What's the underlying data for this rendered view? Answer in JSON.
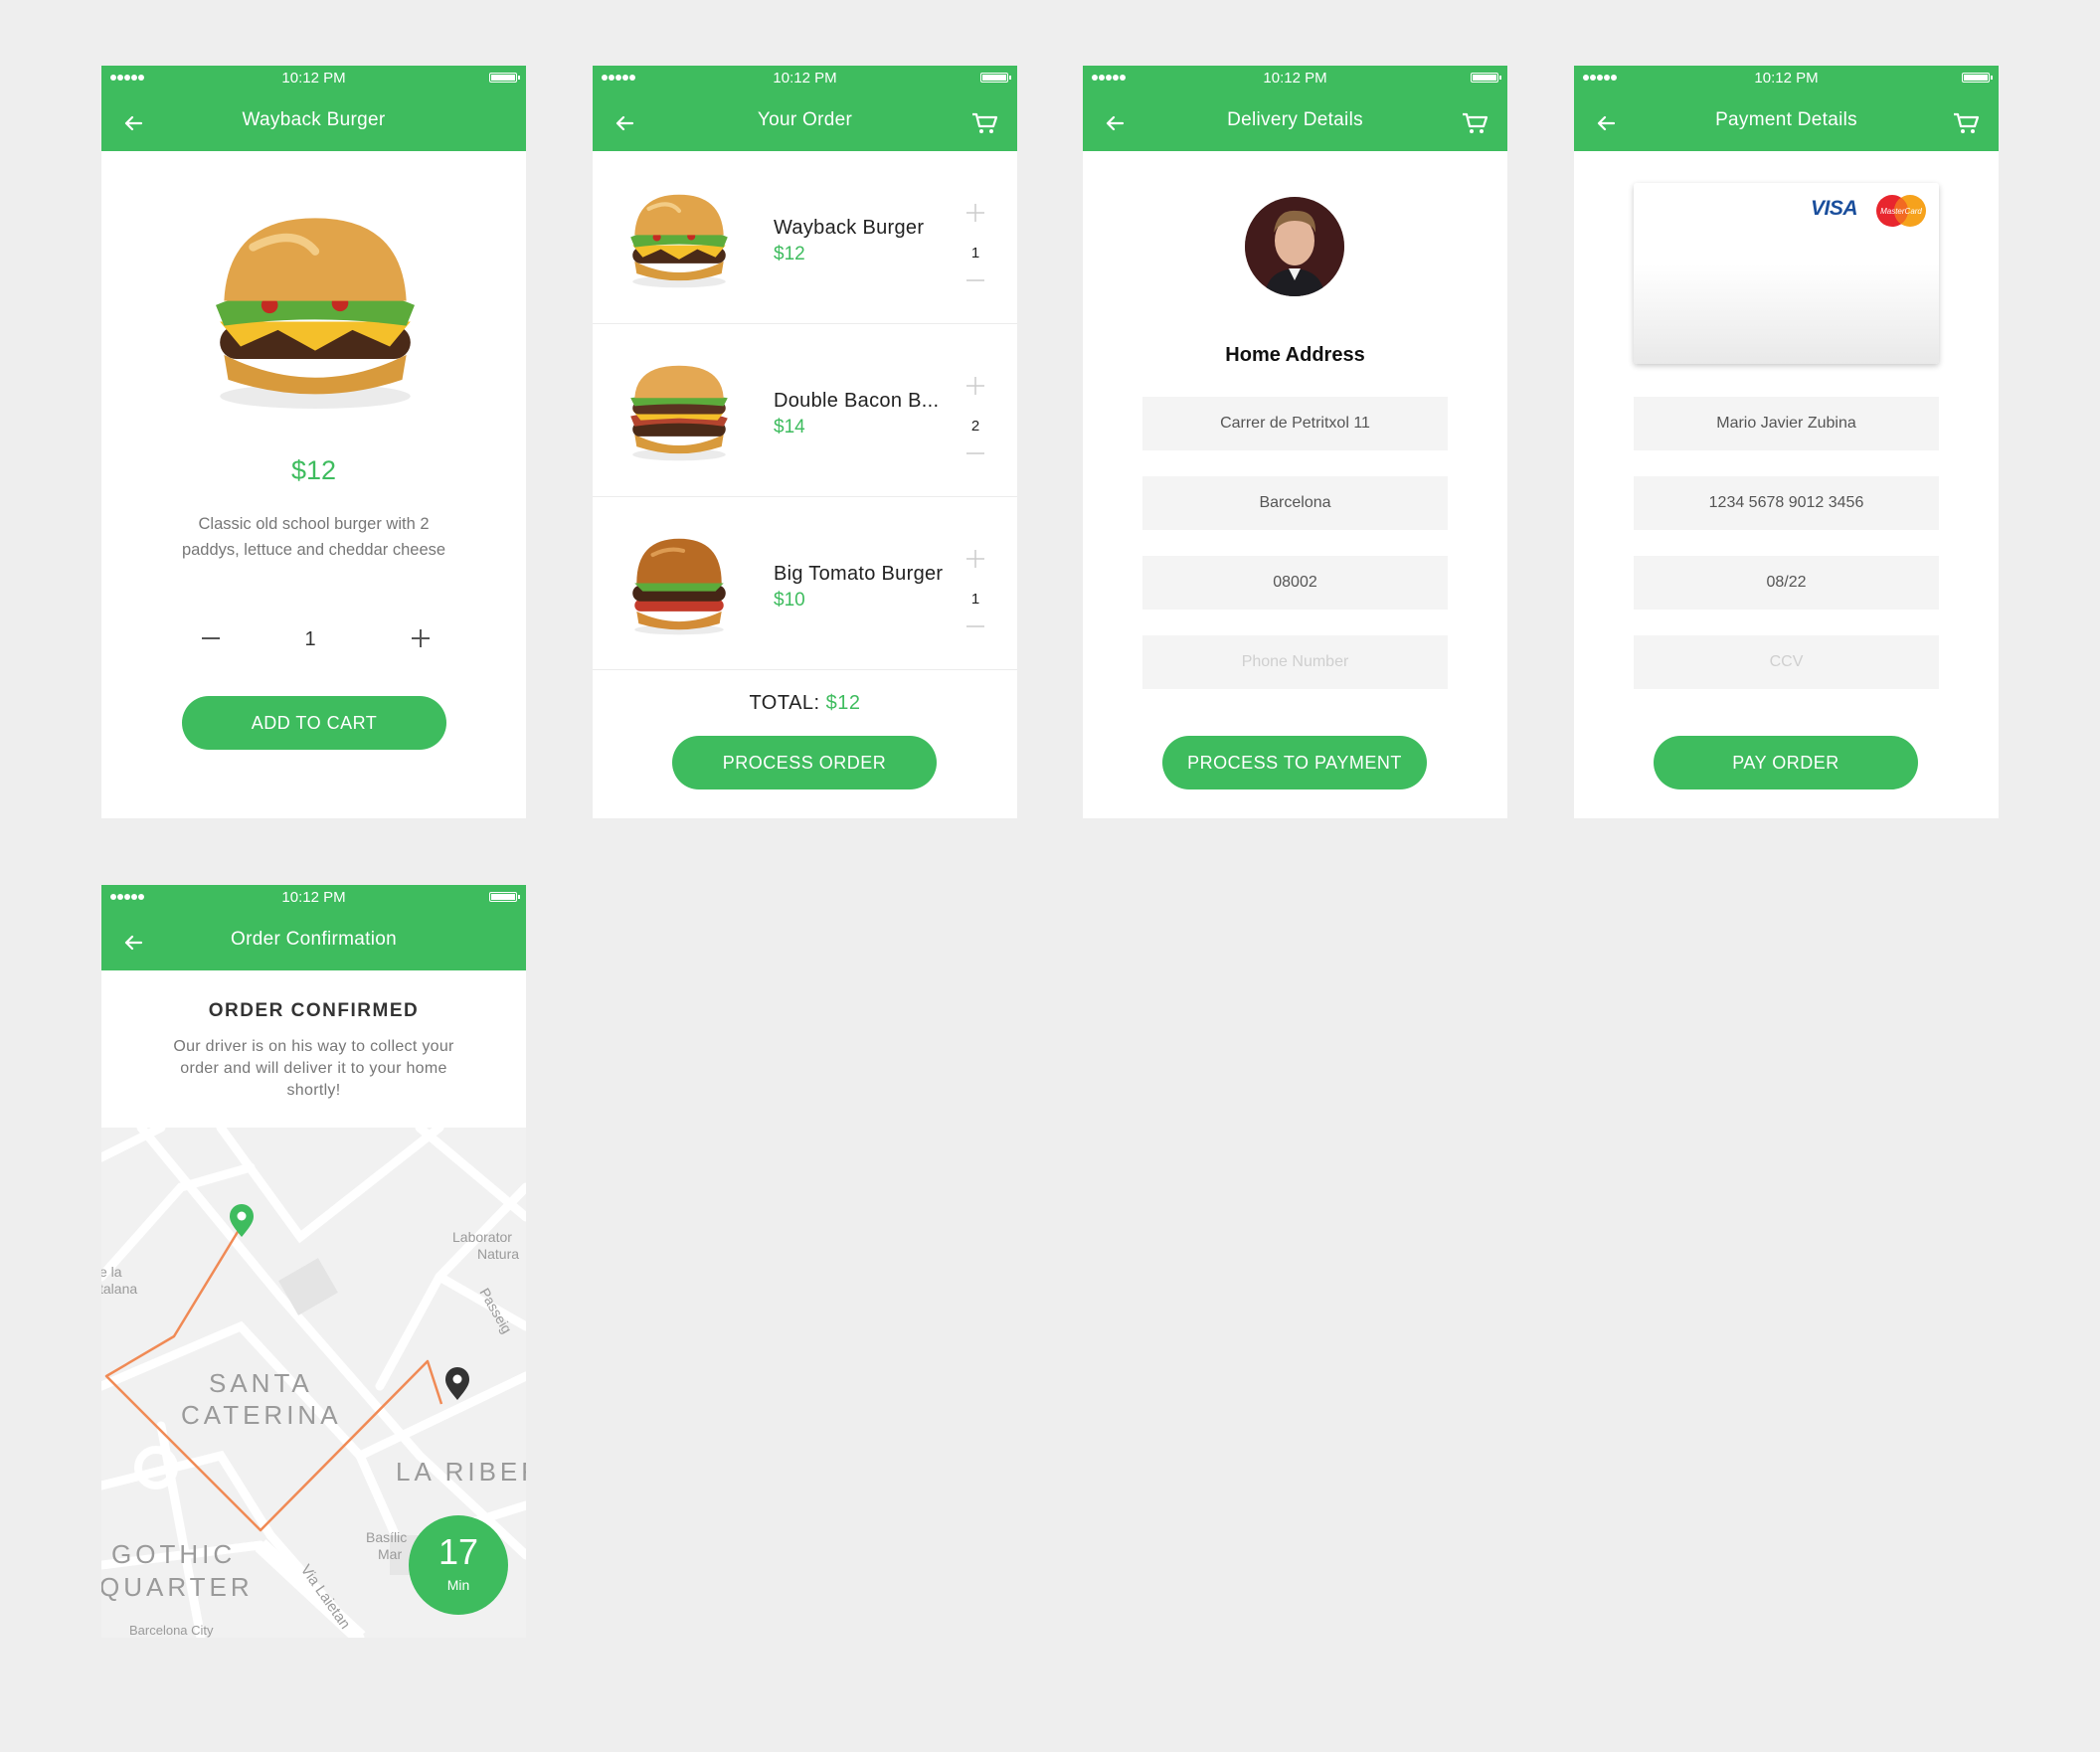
{
  "status_bar": {
    "time": "10:12 PM"
  },
  "screens": {
    "product": {
      "title": "Wayback Burger",
      "price": "$12",
      "description": "Classic old school burger with 2 paddys, lettuce and cheddar cheese",
      "quantity": "1",
      "button": "ADD TO CART"
    },
    "order": {
      "title": "Your Order",
      "items": [
        {
          "name": "Wayback Burger",
          "price": "$12",
          "qty": "1"
        },
        {
          "name": "Double Bacon B...",
          "price": "$14",
          "qty": "2"
        },
        {
          "name": "Big Tomato Burger",
          "price": "$10",
          "qty": "1"
        }
      ],
      "total_label": "TOTAL:",
      "total_value": "$12",
      "button": "PROCESS ORDER"
    },
    "delivery": {
      "title": "Delivery Details",
      "section": "Home Address",
      "fields": {
        "address": "Carrer de Petritxol 11",
        "city": "Barcelona",
        "zip": "08002",
        "phone_placeholder": "Phone Number"
      },
      "button": "PROCESS TO PAYMENT"
    },
    "payment": {
      "title": "Payment Details",
      "card_brands": {
        "visa": "VISA",
        "mastercard": "MasterCard"
      },
      "fields": {
        "name": "Mario Javier Zubina",
        "number": "1234 5678 9012 3456",
        "expiry": "08/22",
        "ccv_placeholder": "CCV"
      },
      "button": "PAY ORDER"
    },
    "confirmation": {
      "title": "Order Confirmation",
      "heading": "ORDER CONFIRMED",
      "text": "Our driver is on his way to collect your order and will deliver it to your home shortly!",
      "map_labels": {
        "la_catalana_1": "e la",
        "la_catalana_2": "talana",
        "laboratori_1": "Laborator",
        "laboratori_2": "Natura",
        "passeig": "Passeig",
        "santa_1": "SANTA",
        "santa_2": "CATERINA",
        "ribera": "LA RIBEF",
        "basilica_1": "Basílic",
        "basilica_2": "Mar",
        "gothic_1": "GOTHIC",
        "gothic_2": "QUARTER",
        "via_laietana": "Via Laietan",
        "barcelona_city": "Barcelona City"
      },
      "eta_value": "17",
      "eta_unit": "Min"
    }
  },
  "colors": {
    "brand_green": "#3ebc5e",
    "route": "#f08a55",
    "background": "#eeeeee"
  },
  "icons": [
    "back-arrow-icon",
    "cart-icon",
    "minus-icon",
    "plus-icon",
    "map-pin-icon"
  ]
}
